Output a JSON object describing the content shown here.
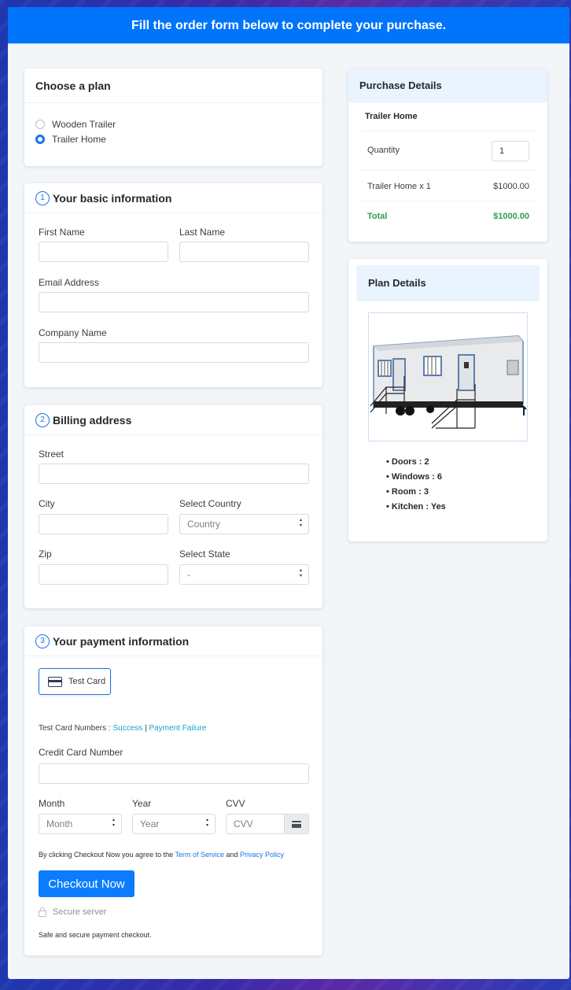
{
  "banner": {
    "title": "Fill the order form below to complete your purchase."
  },
  "plan": {
    "title": "Choose a plan",
    "options": [
      {
        "label": "Wooden Trailer",
        "selected": false
      },
      {
        "label": "Trailer Home",
        "selected": true
      }
    ]
  },
  "basic": {
    "step": "1",
    "title": "Your basic information",
    "first_name_label": "First Name",
    "last_name_label": "Last Name",
    "email_label": "Email Address",
    "company_label": "Company Name"
  },
  "billing": {
    "step": "2",
    "title": "Billing address",
    "street_label": "Street",
    "city_label": "City",
    "country_label": "Select Country",
    "country_value": "Country",
    "zip_label": "Zip",
    "state_label": "Select State",
    "state_value": "-"
  },
  "payment": {
    "step": "3",
    "title": "Your payment information",
    "method_label": "Test Card",
    "test_numbers_label": "Test Card Numbers :",
    "success_link": "Success",
    "separator": "|",
    "failure_link": "Payment Failure",
    "card_number_label": "Credit Card Number",
    "month_label": "Month",
    "month_value": "Month",
    "year_label": "Year",
    "year_value": "Year",
    "cvv_label": "CVV",
    "cvv_placeholder": "CVV",
    "terms_prefix": "By clicking Checkout Now you agree to the",
    "terms_link": "Term of Service",
    "terms_and": "and",
    "privacy_link": "Privacy Policy",
    "checkout_button": "Checkout Now",
    "secure_label": "Secure server",
    "safe_note": "Safe and secure payment checkout."
  },
  "purchase": {
    "title": "Purchase Details",
    "product": "Trailer Home",
    "quantity_label": "Quantity",
    "quantity_value": "1",
    "line_label": "Trailer Home x 1",
    "line_amount": "$1000.00",
    "total_label": "Total",
    "total_amount": "$1000.00",
    "total_color": "#2aa14b"
  },
  "plan_details": {
    "title": "Plan Details",
    "features": [
      "Doors : 2",
      "Windows : 6",
      "Room : 3",
      "Kitchen : Yes"
    ]
  }
}
